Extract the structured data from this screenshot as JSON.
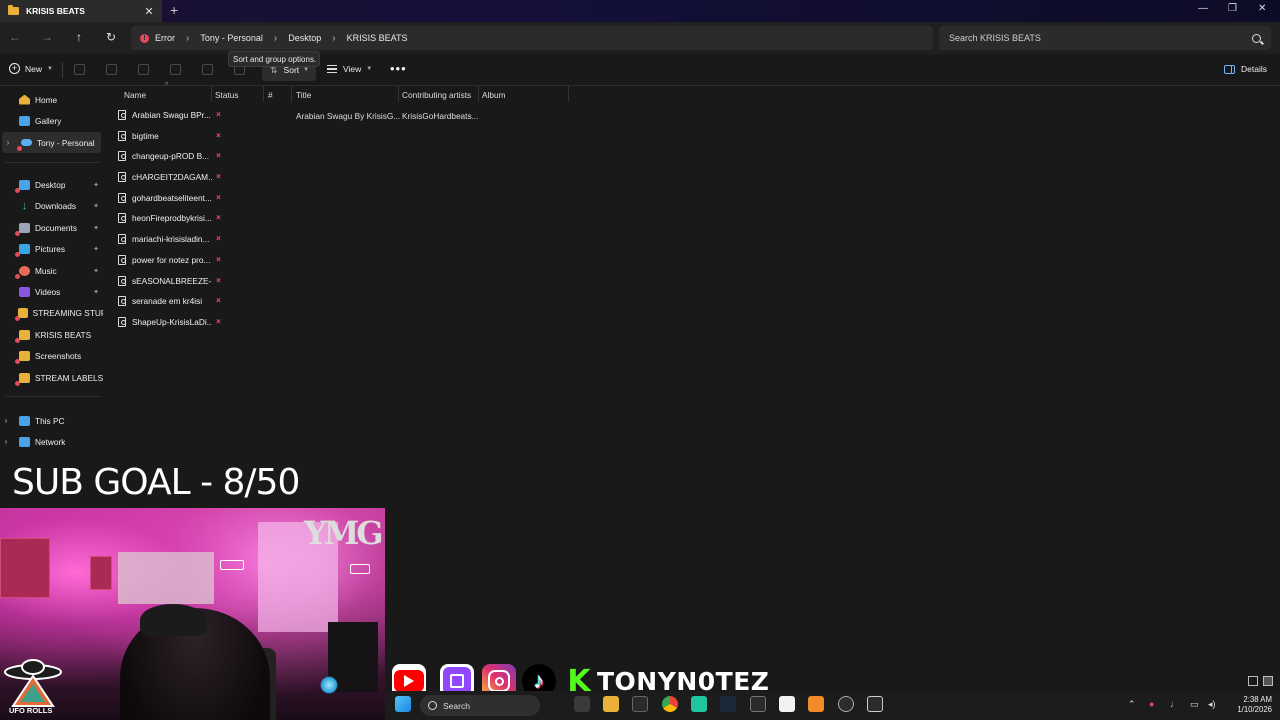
{
  "window": {
    "tab_title": "KRISIS BEATS",
    "tab_close": "✕",
    "new_tab": "+",
    "controls": {
      "minimize": "—",
      "maximize": "❐",
      "close": "✕"
    }
  },
  "nav": {
    "back": "←",
    "forward": "→",
    "up": "↑",
    "refresh": "↻",
    "breadcrumb": [
      "Error",
      "Tony - Personal",
      "Desktop",
      "KRISIS BEATS"
    ],
    "separator": "›",
    "search_placeholder": "Search KRISIS BEATS"
  },
  "toolbar": {
    "new_label": "New",
    "sort_label": "Sort",
    "view_label": "View",
    "more_label": "•••",
    "details_label": "Details",
    "tooltip": "Sort and group options."
  },
  "sidebar": {
    "items": [
      {
        "label": "Home",
        "icon": "home-icon",
        "color": "#e8b13a"
      },
      {
        "label": "Gallery",
        "icon": "gallery-icon",
        "color": "#4aa3e8"
      },
      {
        "label": "Tony - Personal",
        "icon": "onedrive-icon",
        "color": "#5ab0f5"
      },
      {
        "label": "Desktop",
        "icon": "desktop-icon",
        "color": "#4aa3e8"
      },
      {
        "label": "Downloads",
        "icon": "download-icon",
        "color": "#3fbf9a"
      },
      {
        "label": "Documents",
        "icon": "documents-icon",
        "color": "#9aa6b8"
      },
      {
        "label": "Pictures",
        "icon": "pictures-icon",
        "color": "#3aa6e6"
      },
      {
        "label": "Music",
        "icon": "music-icon",
        "color": "#e86a5a"
      },
      {
        "label": "Videos",
        "icon": "videos-icon",
        "color": "#8a56e0"
      },
      {
        "label": "STREAMING STUFF",
        "icon": "folder-icon",
        "color": "#e8b13a"
      },
      {
        "label": "KRISIS BEATS",
        "icon": "folder-icon",
        "color": "#e8b13a"
      },
      {
        "label": "Screenshots",
        "icon": "folder-icon",
        "color": "#e8b13a"
      },
      {
        "label": "STREAM LABELS",
        "icon": "folder-icon",
        "color": "#e8b13a"
      },
      {
        "label": "This PC",
        "icon": "pc-icon",
        "color": "#4aa3e8"
      },
      {
        "label": "Network",
        "icon": "network-icon",
        "color": "#4aa3e8"
      }
    ]
  },
  "columns": {
    "name": "Name",
    "status": "Status",
    "number": "#",
    "title": "Title",
    "contributing_artists": "Contributing artists",
    "album": "Album"
  },
  "files": [
    {
      "name": "Arabian Swagu BPr...",
      "title": "Arabian Swagu By KrisisG...",
      "artist": "KrisisGoHardbeats..."
    },
    {
      "name": "bigtime",
      "title": "",
      "artist": ""
    },
    {
      "name": "changeup-pROD B...",
      "title": "",
      "artist": ""
    },
    {
      "name": "cHARGEIT2DAGAM...",
      "title": "",
      "artist": ""
    },
    {
      "name": "gohardbeatseliteent...",
      "title": "",
      "artist": ""
    },
    {
      "name": "heonFireprodbykrisi...",
      "title": "",
      "artist": ""
    },
    {
      "name": "mariachi-krisisladin...",
      "title": "",
      "artist": ""
    },
    {
      "name": "power for notez pro...",
      "title": "",
      "artist": ""
    },
    {
      "name": "sEASONALBREEZE-...",
      "title": "",
      "artist": ""
    },
    {
      "name": "seranade em kr4isi",
      "title": "",
      "artist": ""
    },
    {
      "name": "ShapeUp-KrisisLaDi...",
      "title": "",
      "artist": ""
    }
  ],
  "status_mark": "×",
  "overlay": {
    "sub_goal": "SUB GOAL -  8/50",
    "handle": "TONYN0TEZ",
    "ufo_text": "UFO ROLLS",
    "webcam_logo": "YMG",
    "socials": [
      "youtube-icon",
      "twitch-icon",
      "instagram-icon",
      "tiktok-icon",
      "kick-icon"
    ]
  },
  "taskbar": {
    "search_label": "Search",
    "time": "2:38 AM",
    "date": "1/10/2026"
  }
}
